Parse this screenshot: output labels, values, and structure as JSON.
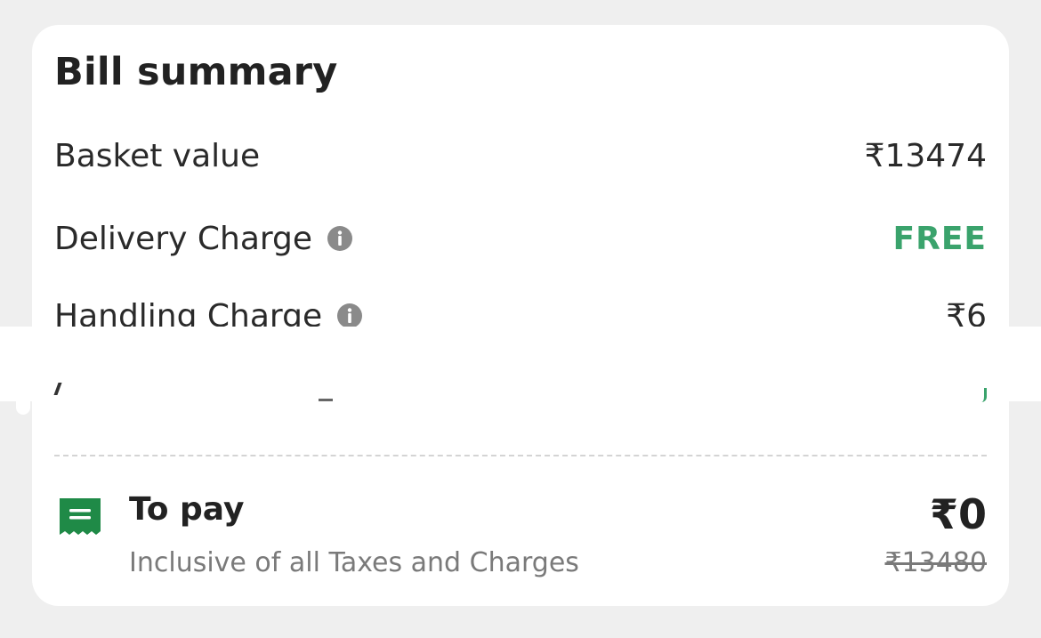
{
  "bill_summary": {
    "title": "Bill summary",
    "rows": [
      {
        "label": "Basket value",
        "value": "₹13474",
        "has_info": false
      },
      {
        "label": "Delivery Charge",
        "value": "FREE",
        "has_info": true
      },
      {
        "label": "Handling Charge",
        "value": "₹6",
        "has_info": true
      }
    ],
    "to_pay": {
      "label": "To pay",
      "subtitle": "Inclusive of all Taxes and Charges",
      "amount": "₹0",
      "original_amount": "₹13480"
    }
  },
  "colors": {
    "free": "#3aa36c",
    "bill_icon": "#1f8a47",
    "info_icon": "#8a8a8a",
    "page_background": "#efefef",
    "card_background": "#ffffff"
  },
  "icons": {
    "info": "info-icon",
    "bill": "receipt-icon"
  }
}
